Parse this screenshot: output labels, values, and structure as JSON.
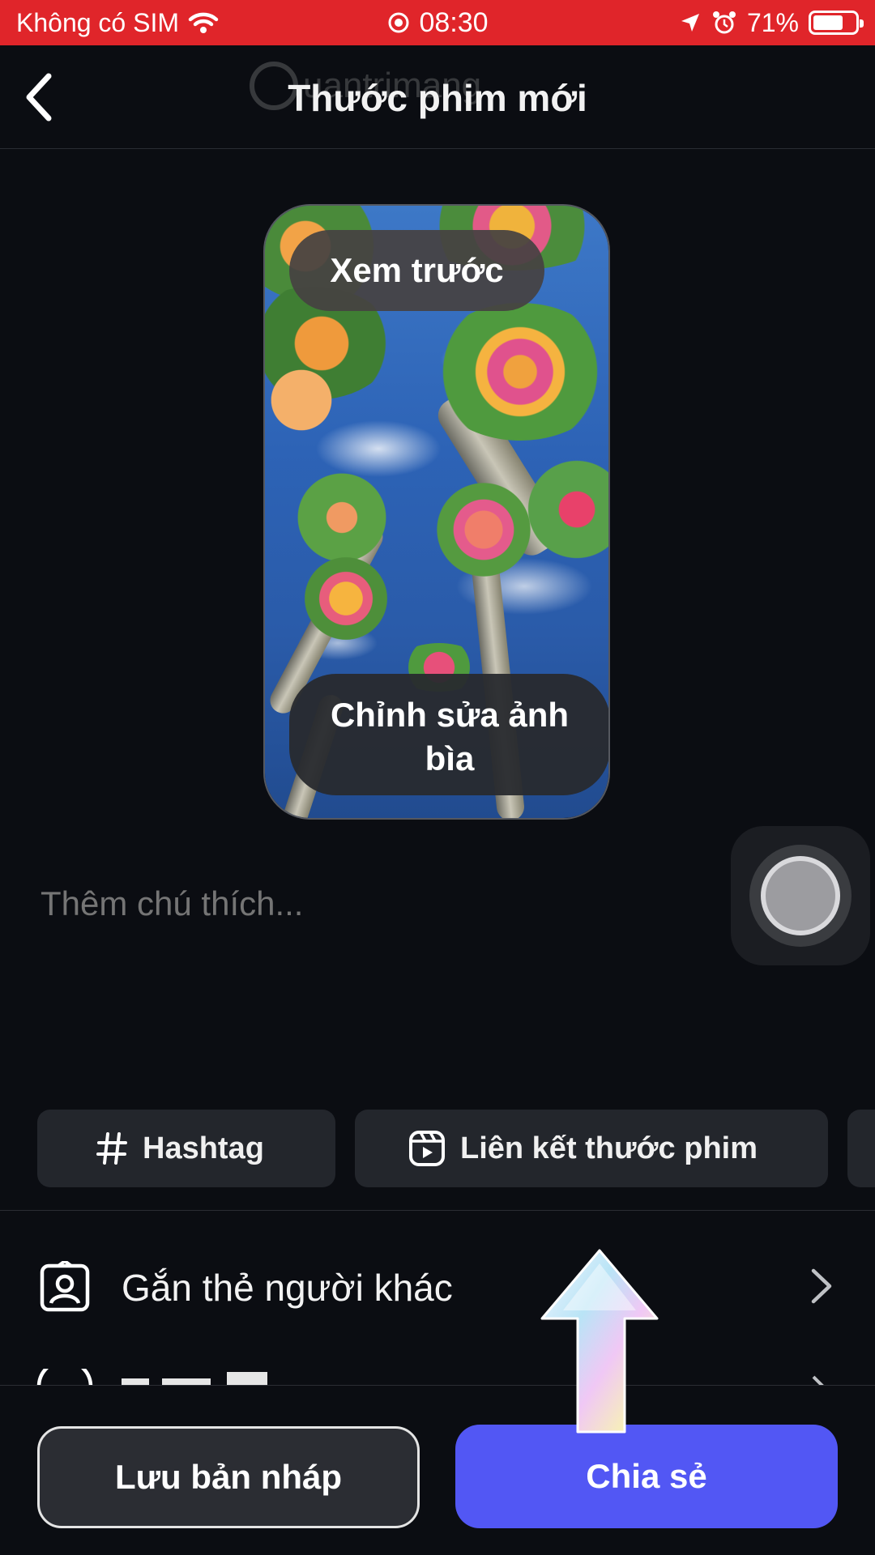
{
  "status_bar": {
    "carrier": "Không có SIM",
    "time": "08:30",
    "battery": "71%",
    "battery_level": 0.71,
    "background": "#e0252a"
  },
  "header": {
    "title": "Thước phim mới",
    "back_icon": "chevron-left-icon"
  },
  "watermark": {
    "text": "uantrimang"
  },
  "preview": {
    "preview_label": "Xem trước",
    "edit_cover_line1": "Chỉnh sửa ảnh",
    "edit_cover_line2": "bìa"
  },
  "caption": {
    "placeholder": "Thêm chú thích..."
  },
  "chips": [
    {
      "label": "Hashtag",
      "icon": "hashtag-icon"
    },
    {
      "label": "Liên kết thước phim",
      "icon": "reel-icon"
    }
  ],
  "options": [
    {
      "label": "Gắn thẻ người khác",
      "icon": "tag-person-icon"
    }
  ],
  "footer": {
    "draft_label": "Lưu bản nháp",
    "share_label": "Chia sẻ",
    "share_color": "#5257f4"
  }
}
